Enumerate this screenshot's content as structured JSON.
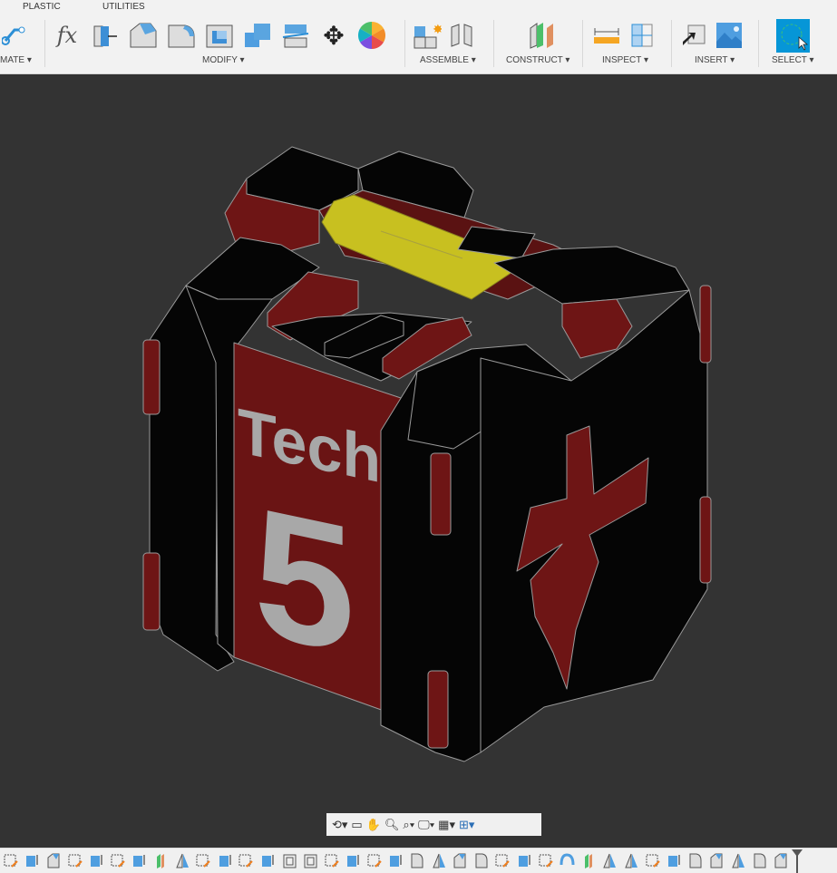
{
  "tabs": [
    "PLASTIC",
    "UTILITIES"
  ],
  "groups": {
    "automate": "MATE",
    "modify": "MODIFY",
    "assemble": "ASSEMBLE",
    "construct": "CONSTRUCT",
    "inspect": "INSPECT",
    "insert": "INSERT",
    "select": "SELECT"
  },
  "dropdown_glyph": "▾",
  "modify_icons": [
    "fx",
    "press-pull",
    "fillet",
    "chamfer",
    "shell",
    "combine",
    "split",
    "move",
    "appearance"
  ],
  "model_decal": {
    "word": "Tech",
    "number": "5"
  },
  "colors": {
    "viewport": "#333333",
    "toolbar": "#f2f2f2",
    "model_red": "#6e1515",
    "model_black": "#050505",
    "accent_blue": "#0696d7",
    "yellow": "#c8c020"
  },
  "navbar_icons": [
    "orbit-icon",
    "look-at-icon",
    "pan-icon",
    "zoom-icon",
    "fit-icon",
    "display-settings-icon",
    "grid-icon",
    "viewports-icon"
  ],
  "timeline": [
    "sketch",
    "extrude",
    "chamfer",
    "sketch",
    "extrude",
    "sketch",
    "extrude",
    "plane",
    "mirror",
    "sketch",
    "extrude",
    "sketch",
    "extrude",
    "shell",
    "shell",
    "sketch",
    "extrude",
    "sketch",
    "extrude",
    "fillet",
    "mirror",
    "chamfer",
    "fillet",
    "sketch",
    "extrude",
    "sketch",
    "revolve",
    "plane",
    "mirror",
    "mirror",
    "sketch",
    "extrude",
    "fillet",
    "chamfer",
    "mirror",
    "fillet",
    "chamfer"
  ]
}
